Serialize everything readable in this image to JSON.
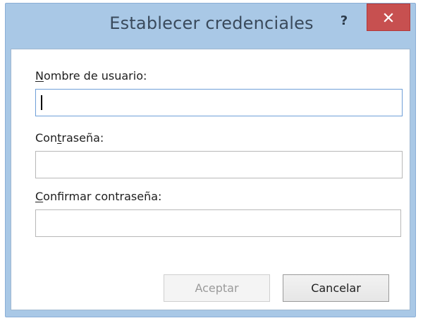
{
  "dialog": {
    "title": "Establecer credenciales",
    "help_icon": "question-mark-icon",
    "help_glyph": "?",
    "close_icon": "close-icon",
    "close_color": "#c75050"
  },
  "form": {
    "username": {
      "label_accel": "N",
      "label_rest_before": "",
      "label_rest": "ombre de usuario:",
      "value": ""
    },
    "password": {
      "label_before": "Con",
      "label_accel": "t",
      "label_rest": "raseña:",
      "value": ""
    },
    "confirm": {
      "label_accel": "C",
      "label_rest": "onfirmar contraseña:",
      "value": ""
    }
  },
  "buttons": {
    "ok_label": "Aceptar",
    "cancel_label": "Cancelar"
  },
  "colors": {
    "frame": "#a9c8e6",
    "focus_border": "#6f9fd8"
  }
}
